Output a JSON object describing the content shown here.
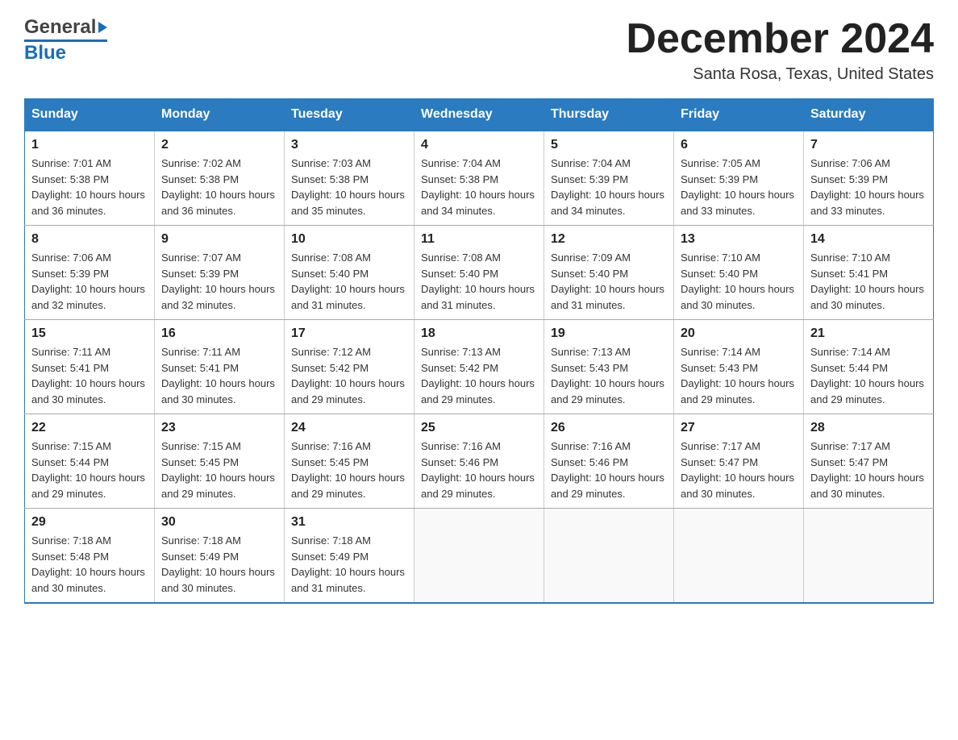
{
  "header": {
    "logo": {
      "general": "General",
      "blue": "Blue",
      "arrow_label": "logo-arrow"
    },
    "title": "December 2024",
    "subtitle": "Santa Rosa, Texas, United States"
  },
  "calendar": {
    "days_of_week": [
      "Sunday",
      "Monday",
      "Tuesday",
      "Wednesday",
      "Thursday",
      "Friday",
      "Saturday"
    ],
    "weeks": [
      [
        {
          "day": "1",
          "sunrise": "7:01 AM",
          "sunset": "5:38 PM",
          "daylight": "10 hours and 36 minutes."
        },
        {
          "day": "2",
          "sunrise": "7:02 AM",
          "sunset": "5:38 PM",
          "daylight": "10 hours and 36 minutes."
        },
        {
          "day": "3",
          "sunrise": "7:03 AM",
          "sunset": "5:38 PM",
          "daylight": "10 hours and 35 minutes."
        },
        {
          "day": "4",
          "sunrise": "7:04 AM",
          "sunset": "5:38 PM",
          "daylight": "10 hours and 34 minutes."
        },
        {
          "day": "5",
          "sunrise": "7:04 AM",
          "sunset": "5:39 PM",
          "daylight": "10 hours and 34 minutes."
        },
        {
          "day": "6",
          "sunrise": "7:05 AM",
          "sunset": "5:39 PM",
          "daylight": "10 hours and 33 minutes."
        },
        {
          "day": "7",
          "sunrise": "7:06 AM",
          "sunset": "5:39 PM",
          "daylight": "10 hours and 33 minutes."
        }
      ],
      [
        {
          "day": "8",
          "sunrise": "7:06 AM",
          "sunset": "5:39 PM",
          "daylight": "10 hours and 32 minutes."
        },
        {
          "day": "9",
          "sunrise": "7:07 AM",
          "sunset": "5:39 PM",
          "daylight": "10 hours and 32 minutes."
        },
        {
          "day": "10",
          "sunrise": "7:08 AM",
          "sunset": "5:40 PM",
          "daylight": "10 hours and 31 minutes."
        },
        {
          "day": "11",
          "sunrise": "7:08 AM",
          "sunset": "5:40 PM",
          "daylight": "10 hours and 31 minutes."
        },
        {
          "day": "12",
          "sunrise": "7:09 AM",
          "sunset": "5:40 PM",
          "daylight": "10 hours and 31 minutes."
        },
        {
          "day": "13",
          "sunrise": "7:10 AM",
          "sunset": "5:40 PM",
          "daylight": "10 hours and 30 minutes."
        },
        {
          "day": "14",
          "sunrise": "7:10 AM",
          "sunset": "5:41 PM",
          "daylight": "10 hours and 30 minutes."
        }
      ],
      [
        {
          "day": "15",
          "sunrise": "7:11 AM",
          "sunset": "5:41 PM",
          "daylight": "10 hours and 30 minutes."
        },
        {
          "day": "16",
          "sunrise": "7:11 AM",
          "sunset": "5:41 PM",
          "daylight": "10 hours and 30 minutes."
        },
        {
          "day": "17",
          "sunrise": "7:12 AM",
          "sunset": "5:42 PM",
          "daylight": "10 hours and 29 minutes."
        },
        {
          "day": "18",
          "sunrise": "7:13 AM",
          "sunset": "5:42 PM",
          "daylight": "10 hours and 29 minutes."
        },
        {
          "day": "19",
          "sunrise": "7:13 AM",
          "sunset": "5:43 PM",
          "daylight": "10 hours and 29 minutes."
        },
        {
          "day": "20",
          "sunrise": "7:14 AM",
          "sunset": "5:43 PM",
          "daylight": "10 hours and 29 minutes."
        },
        {
          "day": "21",
          "sunrise": "7:14 AM",
          "sunset": "5:44 PM",
          "daylight": "10 hours and 29 minutes."
        }
      ],
      [
        {
          "day": "22",
          "sunrise": "7:15 AM",
          "sunset": "5:44 PM",
          "daylight": "10 hours and 29 minutes."
        },
        {
          "day": "23",
          "sunrise": "7:15 AM",
          "sunset": "5:45 PM",
          "daylight": "10 hours and 29 minutes."
        },
        {
          "day": "24",
          "sunrise": "7:16 AM",
          "sunset": "5:45 PM",
          "daylight": "10 hours and 29 minutes."
        },
        {
          "day": "25",
          "sunrise": "7:16 AM",
          "sunset": "5:46 PM",
          "daylight": "10 hours and 29 minutes."
        },
        {
          "day": "26",
          "sunrise": "7:16 AM",
          "sunset": "5:46 PM",
          "daylight": "10 hours and 29 minutes."
        },
        {
          "day": "27",
          "sunrise": "7:17 AM",
          "sunset": "5:47 PM",
          "daylight": "10 hours and 30 minutes."
        },
        {
          "day": "28",
          "sunrise": "7:17 AM",
          "sunset": "5:47 PM",
          "daylight": "10 hours and 30 minutes."
        }
      ],
      [
        {
          "day": "29",
          "sunrise": "7:18 AM",
          "sunset": "5:48 PM",
          "daylight": "10 hours and 30 minutes."
        },
        {
          "day": "30",
          "sunrise": "7:18 AM",
          "sunset": "5:49 PM",
          "daylight": "10 hours and 30 minutes."
        },
        {
          "day": "31",
          "sunrise": "7:18 AM",
          "sunset": "5:49 PM",
          "daylight": "10 hours and 31 minutes."
        },
        null,
        null,
        null,
        null
      ]
    ],
    "sunrise_label": "Sunrise:",
    "sunset_label": "Sunset:",
    "daylight_label": "Daylight:"
  }
}
